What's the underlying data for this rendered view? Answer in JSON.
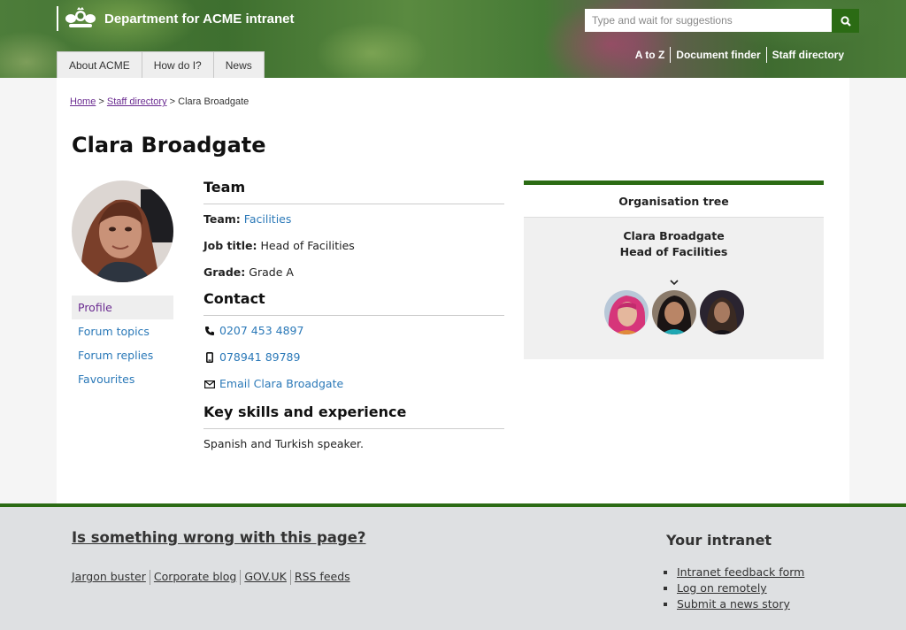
{
  "header": {
    "site_title": "Department for ACME intranet",
    "search_placeholder": "Type and wait for suggestions",
    "nav_tabs": [
      "About ACME",
      "How do I?",
      "News"
    ],
    "utility_links": [
      "A to Z",
      "Document finder",
      "Staff directory"
    ],
    "brand_color": "#2b6b14"
  },
  "breadcrumb": {
    "home": "Home",
    "sep1": ">",
    "staff_directory": "Staff directory",
    "sep2": ">",
    "current": "Clara Broadgate"
  },
  "profile": {
    "name": "Clara Broadgate",
    "sidenav": [
      "Profile",
      "Forum topics",
      "Forum replies",
      "Favourites"
    ],
    "team_heading": "Team",
    "team_label": "Team:",
    "team_value": "Facilities",
    "job_label": "Job title:",
    "job_value": "Head of Facilities",
    "grade_label": "Grade:",
    "grade_value": "Grade A",
    "contact_heading": "Contact",
    "phone": "0207 453 4897",
    "mobile": "078941 89789",
    "email_link": "Email Clara Broadgate",
    "skills_heading": "Key skills and experience",
    "skills_text": "Spanish and Turkish speaker."
  },
  "org_tree": {
    "title": "Organisation tree",
    "person_name": "Clara Broadgate",
    "person_title": "Head of Facilities"
  },
  "footer": {
    "wrong_link": "Is something wrong with this page?",
    "links": [
      "Jargon buster",
      "Corporate blog",
      "GOV.UK",
      "RSS feeds"
    ],
    "your_intranet_heading": "Your intranet",
    "your_intranet_links": [
      "Intranet feedback form",
      "Log on remotely",
      "Submit a news story"
    ]
  }
}
